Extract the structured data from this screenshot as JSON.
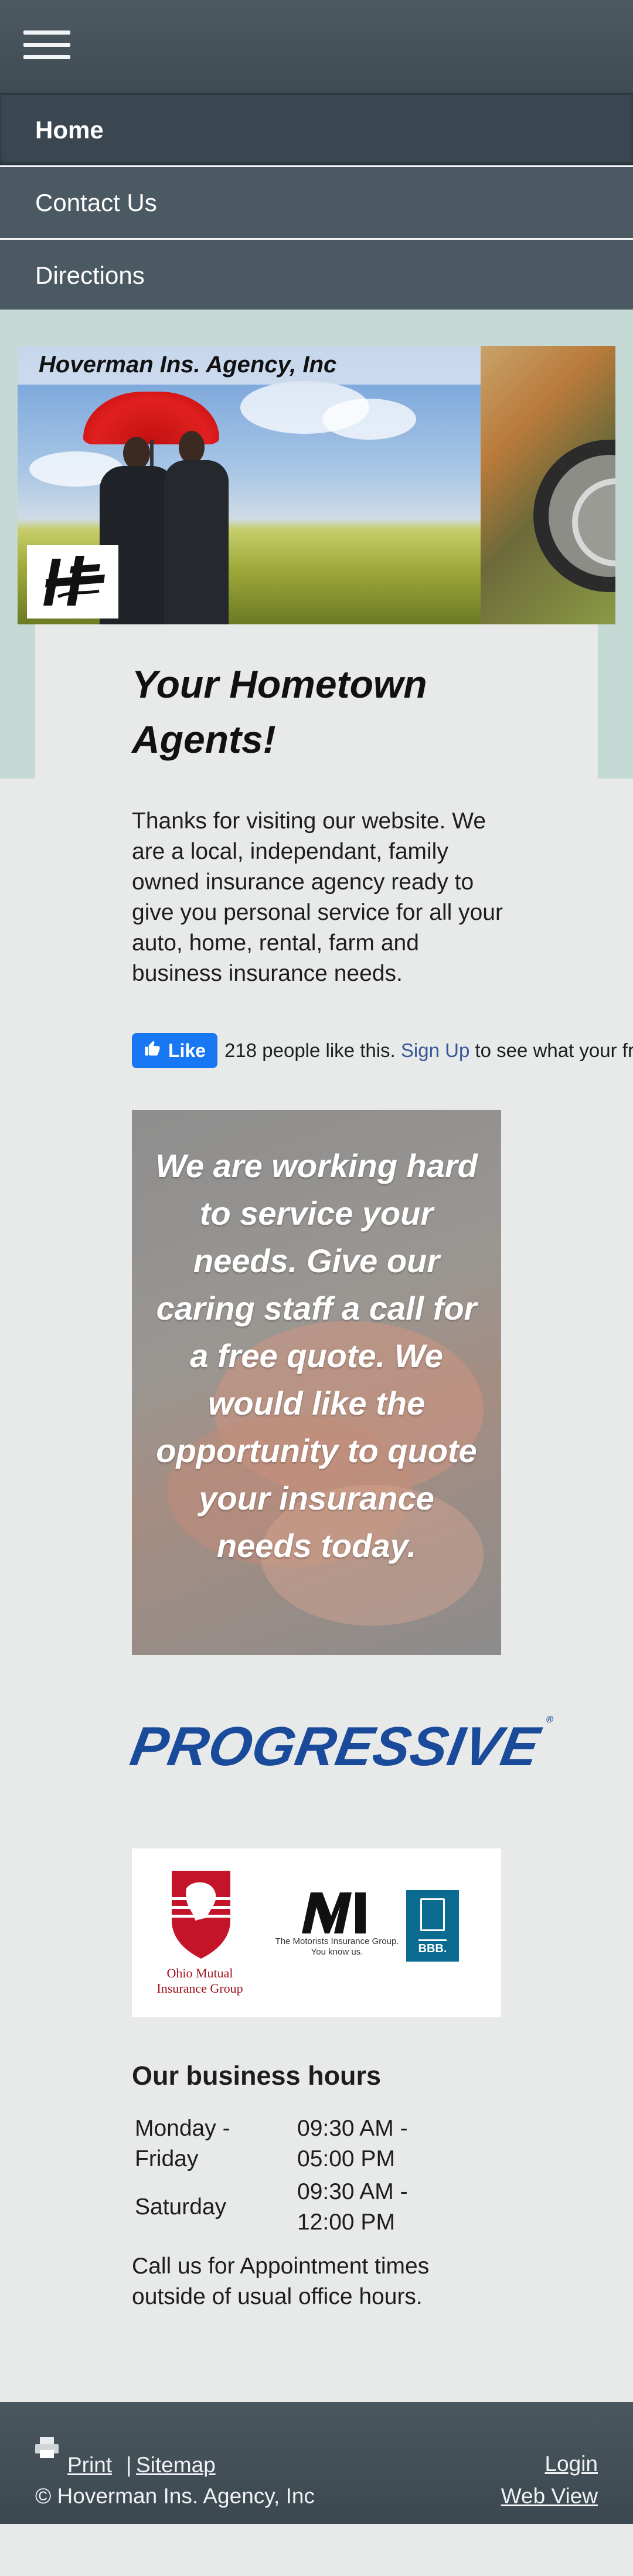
{
  "nav": {
    "items": [
      {
        "label": "Home",
        "active": true
      },
      {
        "label": "Contact Us",
        "active": false
      },
      {
        "label": "Directions",
        "active": false
      }
    ]
  },
  "banner": {
    "title": "Hoverman Ins. Agency, Inc"
  },
  "main": {
    "headline": "Your Hometown Agents!",
    "intro": "Thanks for visiting our website. We are a local, independant, family owned insurance agency ready to give you personal service for all your auto, home, rental, farm and business insurance needs.",
    "facebook": {
      "like_label": "Like",
      "count_text": "218 people like this.",
      "signup_label": "Sign Up",
      "signup_suffix": "to see what your friends like."
    },
    "quote": "We are working hard to service your needs.  Give our caring staff a call for a free quote.  We would like the opportunity to quote your insurance needs today.",
    "progressive_logo": "PROGRESSIVE",
    "partners": {
      "ohio_mutual": "Ohio Mutual Insurance Group",
      "motorists": "The Motorists Insurance Group. You know us.",
      "bbb": "BBB."
    }
  },
  "hours": {
    "title": "Our business hours",
    "rows": [
      {
        "day": "Monday - Friday",
        "time": "09:30 AM - 05:00 PM"
      },
      {
        "day": "Saturday",
        "time": "09:30 AM - 12:00 PM"
      }
    ],
    "note": "Call us for Appointment times outside of usual office hours."
  },
  "footer": {
    "print_label": "Print",
    "separator": "|",
    "sitemap_label": "Sitemap",
    "copyright": "© Hoverman Ins. Agency, Inc",
    "login_label": "Login",
    "webview_label": "Web View"
  },
  "colors": {
    "header_bg": "#47545c",
    "band_bg": "#c5d9d5",
    "page_bg": "#e8eaea",
    "facebook_blue": "#1877f2",
    "progressive_blue": "#1a4b9b"
  },
  "icons": [
    "hamburger-menu-icon",
    "thumbs-up-icon",
    "printer-icon"
  ]
}
